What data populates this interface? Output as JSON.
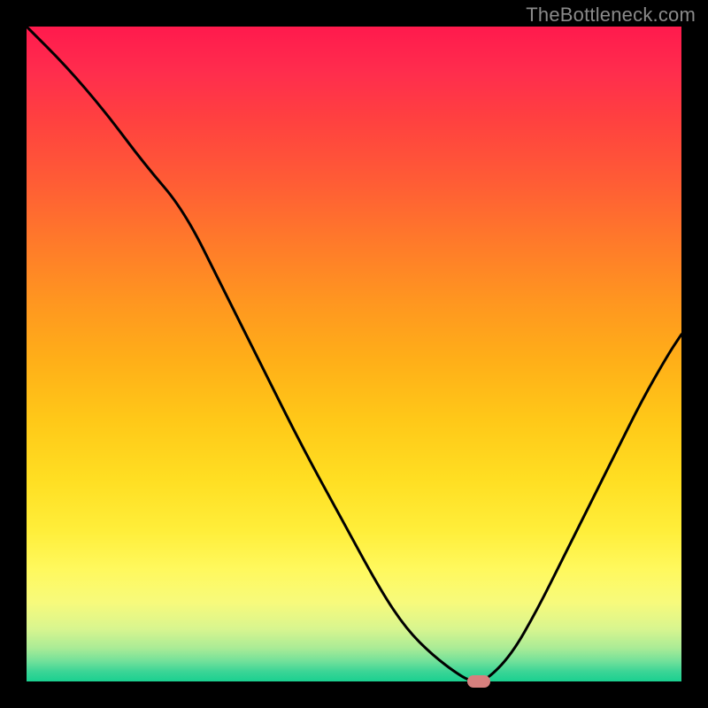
{
  "watermark": "TheBottleneck.com",
  "chart_data": {
    "type": "line",
    "title": "",
    "xlabel": "",
    "ylabel": "",
    "xlim": [
      0,
      100
    ],
    "ylim": [
      0,
      100
    ],
    "grid": false,
    "series": [
      {
        "name": "curve",
        "color": "#000000",
        "x": [
          0,
          6,
          12,
          18,
          24,
          30,
          36,
          42,
          48,
          54,
          58,
          62,
          66,
          68,
          70,
          74,
          78,
          82,
          86,
          90,
          94,
          98,
          100
        ],
        "y": [
          100,
          94,
          87,
          79,
          72,
          60,
          48,
          36,
          25,
          14,
          8,
          4,
          1,
          0,
          0,
          4,
          11,
          19,
          27,
          35,
          43,
          50,
          53
        ]
      }
    ],
    "marker": {
      "x": 69,
      "y": 0,
      "color": "#d6807e"
    },
    "background_gradient": {
      "type": "vertical",
      "stops": [
        {
          "pos": 0.0,
          "color": "#ff1a4d"
        },
        {
          "pos": 0.5,
          "color": "#ffaf18"
        },
        {
          "pos": 0.83,
          "color": "#fff95e"
        },
        {
          "pos": 1.0,
          "color": "#1ad090"
        }
      ]
    }
  }
}
